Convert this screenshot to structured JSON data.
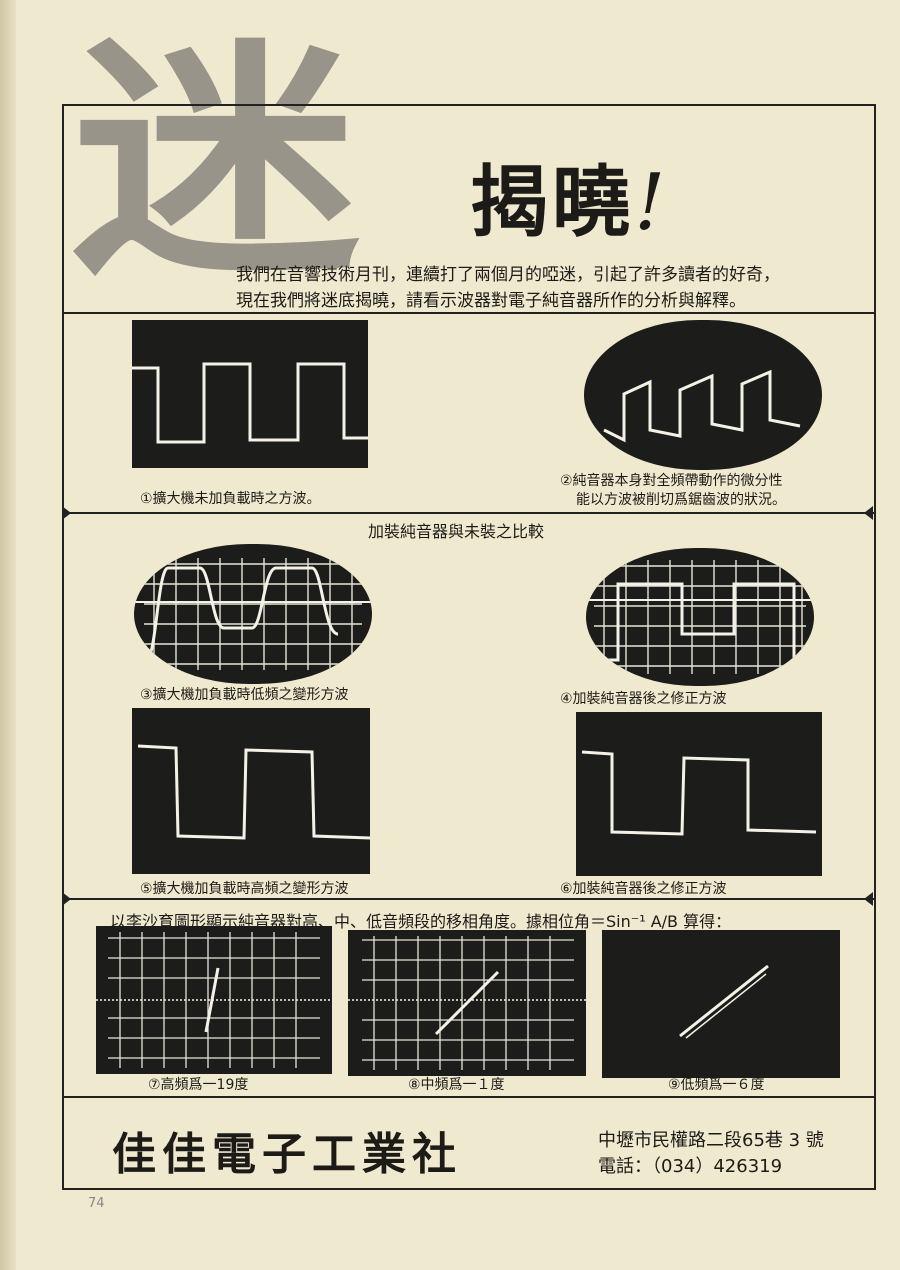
{
  "header": {
    "big_glyph": "迷",
    "title": "揭曉",
    "title_mark": "!",
    "intro_line1": "我們在音響技術月刊，連續打了兩個月的啞迷，引起了許多讀者的好奇，",
    "intro_line2": "現在我們將迷底揭曉，請看示波器對電子純音器所作的分析與解釋。"
  },
  "captions": {
    "c1": "①擴大機未加負載時之方波。",
    "c2_line1": "②純音器本身對全頻帶動作的微分性",
    "c2_line2": "能以方波被削切爲鋸齒波的狀況。",
    "compare_title": "加裝純音器與未裝之比較",
    "c3": "③擴大機加負載時低頻之變形方波",
    "c4": "④加裝純音器後之修正方波",
    "c5": "⑤擴大機加負載時高頻之變形方波",
    "c6": "⑥加裝純音器後之修正方波",
    "lissajous_title": "以李沙育圖形顯示純音器對高、中、低音頻段的移相角度。據相位角＝Sin⁻¹ A/B 算得：",
    "c7": "⑦高頻爲一19度",
    "c8": "⑧中頻爲一１度",
    "c9": "⑨低頻爲一６度"
  },
  "footer": {
    "company": "佳佳電子工業社",
    "address": "中壢市民權路二段65巷 3 號",
    "phone": "電話：（034）426319",
    "page_number": "74"
  },
  "colors": {
    "paper": "#efe9cf",
    "scope_bg": "#1c1c1a",
    "trace": "#f4f1e6"
  }
}
